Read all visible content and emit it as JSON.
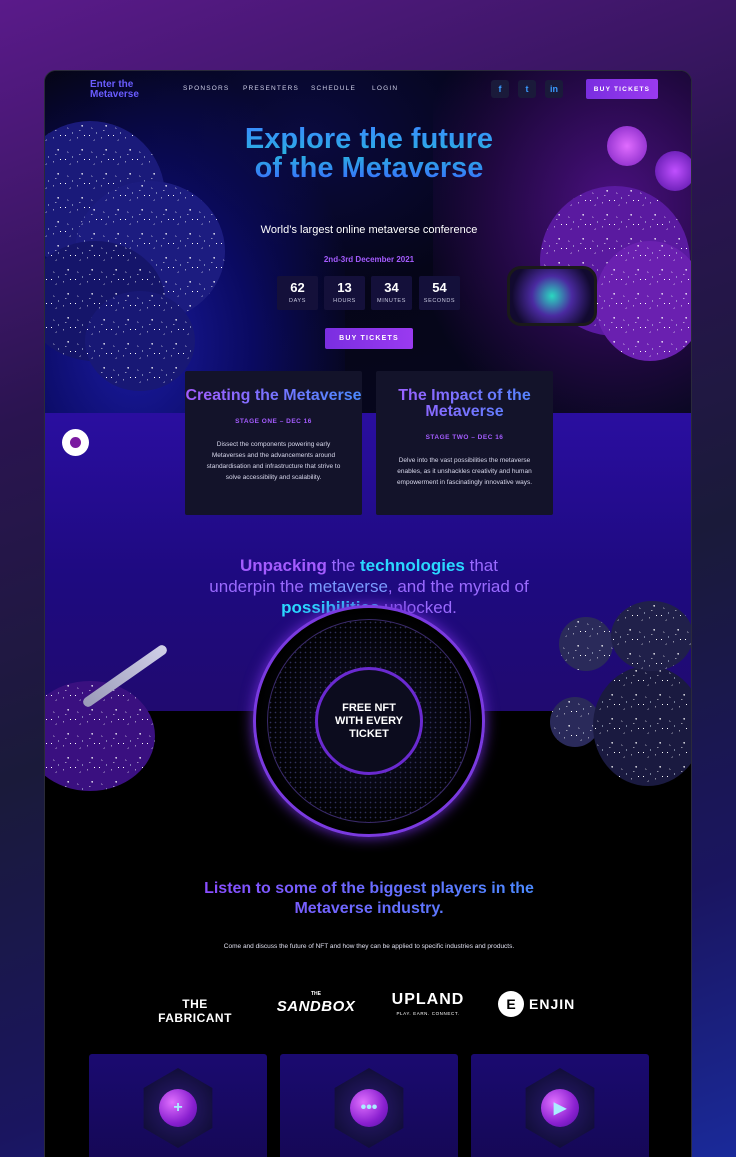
{
  "nav": {
    "logo_line1": "Enter the",
    "logo_line2": "Metaverse",
    "links": [
      "SPONSORS",
      "PRESENTERS",
      "SCHEDULE",
      "LOGIN"
    ],
    "social": [
      "f",
      "t",
      "in"
    ],
    "buy_label": "BUY TICKETS"
  },
  "hero": {
    "title": "Explore the future of the Metaverse",
    "subtitle": "World’s largest online metaverse conference",
    "date": "2nd-3rd December 2021",
    "countdown": [
      {
        "value": "62",
        "label": "DAYS"
      },
      {
        "value": "13",
        "label": "HOURS"
      },
      {
        "value": "34",
        "label": "MINUTES"
      },
      {
        "value": "54",
        "label": "SECONDS"
      }
    ],
    "buy_label": "BUY TICKETS"
  },
  "stages": [
    {
      "title": "Creating the Metaverse",
      "stage": "STAGE ONE – DEC 16",
      "text": "Dissect the components powering early Metaverses and the advancements around standardisation and infrastructure that strive to solve accessibility and scalability."
    },
    {
      "title": "The Impact of the Metaverse",
      "stage": "STAGE TWO – DEC 16",
      "text": "Delve into the vast possibilities the metaverse enables, as it unshackles creativity and human empowerment in fascinatingly innovative ways."
    }
  ],
  "unpack": {
    "w1": "Unpacking",
    "w2": " the ",
    "w3": "technologies",
    "w4": " that underpin the ",
    "w5": "metaverse",
    "w6": ", and the myriad of ",
    "w7": "possibilities",
    "w8": " unlocked."
  },
  "nft": {
    "line1": "FREE NFT",
    "line2": "WITH EVERY",
    "line3": "TICKET"
  },
  "players": {
    "title": "Listen to some of the biggest players in the Metaverse industry.",
    "subtitle": "Come and discuss the future of NFT and how they can be applied to specific industries and products."
  },
  "sponsors": [
    "THE FABRICANT",
    "SANDBOX",
    "UPLAND",
    "ENJIN"
  ],
  "sandbox_small": "THE",
  "upland_tag": "PLAY. EARN. CONNECT.",
  "enjin_mark": "E",
  "tiles": [
    {
      "icon": "game-controller-icon",
      "glyph": "+"
    },
    {
      "icon": "chat-bubble-icon",
      "glyph": "•••"
    },
    {
      "icon": "play-icon",
      "glyph": "▶"
    }
  ]
}
